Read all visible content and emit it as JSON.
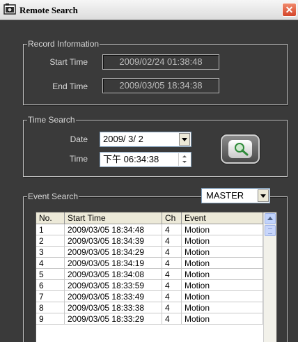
{
  "window": {
    "title": "Remote Search",
    "close_glyph": "✕"
  },
  "record_info": {
    "legend": "Record Information",
    "start_label": "Start Time",
    "start_value": "2009/02/24 01:38:48",
    "end_label": "End Time",
    "end_value": "2009/03/05 18:34:38"
  },
  "time_search": {
    "legend": "Time Search",
    "date_label": "Date",
    "date_value": "2009/ 3/ 2",
    "time_label": "Time",
    "time_value": "下午 06:34:38"
  },
  "event_search": {
    "legend": "Event Search",
    "source_value": "MASTER",
    "columns": [
      "No.",
      "Start Time",
      "Ch",
      "Event"
    ],
    "rows": [
      [
        "1",
        "2009/03/05 18:34:48",
        "4",
        "Motion"
      ],
      [
        "2",
        "2009/03/05 18:34:39",
        "4",
        "Motion"
      ],
      [
        "3",
        "2009/03/05 18:34:29",
        "4",
        "Motion"
      ],
      [
        "4",
        "2009/03/05 18:34:19",
        "4",
        "Motion"
      ],
      [
        "5",
        "2009/03/05 18:34:08",
        "4",
        "Motion"
      ],
      [
        "6",
        "2009/03/05 18:33:59",
        "4",
        "Motion"
      ],
      [
        "7",
        "2009/03/05 18:33:49",
        "4",
        "Motion"
      ],
      [
        "8",
        "2009/03/05 18:33:38",
        "4",
        "Motion"
      ],
      [
        "9",
        "2009/03/05 18:33:29",
        "4",
        "Motion"
      ]
    ]
  },
  "icons": {
    "app": "camera-icon",
    "search": "magnifier-icon",
    "close": "close-icon"
  }
}
